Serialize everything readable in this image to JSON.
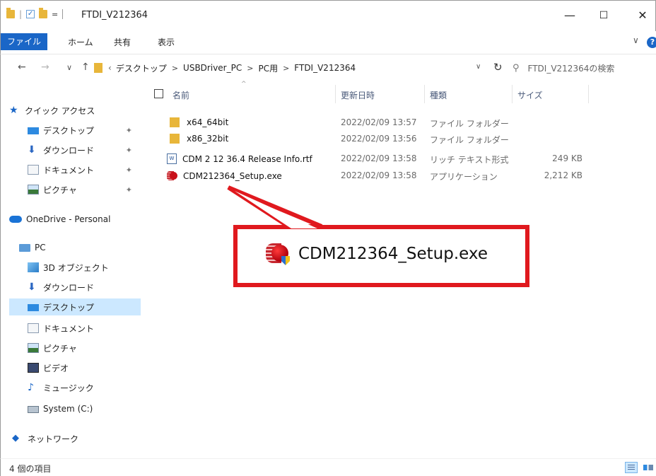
{
  "window": {
    "title": "FTDI_V212364",
    "qat_separator": "|",
    "qat_dropdown": "=",
    "minimize": "—",
    "maximize": "☐",
    "close": "✕"
  },
  "ribbon": {
    "tabs": [
      "ファイル",
      "ホーム",
      "共有",
      "表示"
    ],
    "expand": "∨",
    "help": "?"
  },
  "address": {
    "back": "←",
    "forward": "→",
    "recent": "∨",
    "up": "↑",
    "breadcrumb": [
      "デスクトップ",
      "USBDriver_PC",
      "PC用",
      "FTDI_V212364"
    ],
    "separator": ">",
    "lead": "‹",
    "dropdown": "∨",
    "refresh": "↻",
    "search_placeholder": "FTDI_V212364の検索"
  },
  "navpane": {
    "items": [
      {
        "label": "クイック アクセス",
        "icon": "star-icon",
        "pinned": false
      },
      {
        "label": "デスクトップ",
        "icon": "desktop-icon",
        "pinned": true
      },
      {
        "label": "ダウンロード",
        "icon": "download-icon",
        "pinned": true
      },
      {
        "label": "ドキュメント",
        "icon": "documents-icon",
        "pinned": true
      },
      {
        "label": "ピクチャ",
        "icon": "pictures-icon",
        "pinned": true
      },
      {
        "label": "OneDrive - Personal",
        "icon": "onedrive-icon",
        "pinned": false
      },
      {
        "label": "PC",
        "icon": "pc-icon",
        "pinned": false
      },
      {
        "label": "3D オブジェクト",
        "icon": "3d-objects-icon",
        "pinned": false
      },
      {
        "label": "ダウンロード",
        "icon": "download-icon",
        "pinned": false
      },
      {
        "label": "デスクトップ",
        "icon": "desktop-icon",
        "pinned": false,
        "selected": true
      },
      {
        "label": "ドキュメント",
        "icon": "documents-icon",
        "pinned": false
      },
      {
        "label": "ピクチャ",
        "icon": "pictures-icon",
        "pinned": false
      },
      {
        "label": "ビデオ",
        "icon": "videos-icon",
        "pinned": false
      },
      {
        "label": "ミュージック",
        "icon": "music-icon",
        "pinned": false
      },
      {
        "label": "System (C:)",
        "icon": "drive-icon",
        "pinned": false
      },
      {
        "label": "ネットワーク",
        "icon": "network-icon",
        "pinned": false
      }
    ],
    "pin_glyph": "✦"
  },
  "columns": {
    "name": "名前",
    "date": "更新日時",
    "type": "種類",
    "size": "サイズ",
    "sort_glyph": "^"
  },
  "files": [
    {
      "name": "x64_64bit",
      "date": "2022/02/09 13:57",
      "type": "ファイル フォルダー",
      "size": "",
      "icon": "folder-icon"
    },
    {
      "name": "x86_32bit",
      "date": "2022/02/09 13:56",
      "type": "ファイル フォルダー",
      "size": "",
      "icon": "folder-icon"
    },
    {
      "name": "CDM 2 12 36.4 Release Info.rtf",
      "date": "2022/02/09 13:58",
      "type": "リッチ テキスト形式",
      "size": "249 KB",
      "icon": "rtf-file-icon"
    },
    {
      "name": "CDM212364_Setup.exe",
      "date": "2022/02/09 13:58",
      "type": "アプリケーション",
      "size": "2,212 KB",
      "icon": "exe-file-icon"
    }
  ],
  "callout": {
    "label": "CDM212364_Setup.exe",
    "border_color": "#e0191e"
  },
  "status": {
    "item_count": "4 個の項目"
  },
  "colors": {
    "accent": "#1a66c7",
    "selection": "#cce8ff",
    "folder": "#e8b63a"
  }
}
